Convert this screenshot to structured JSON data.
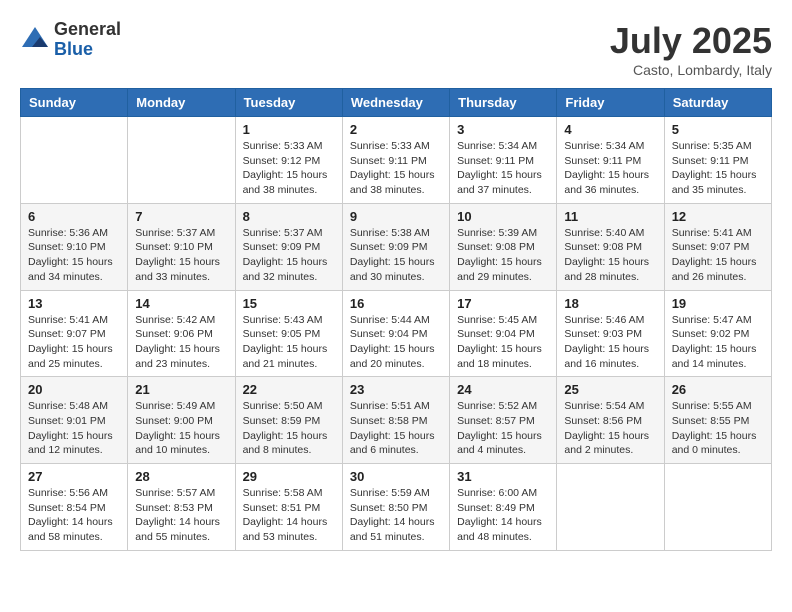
{
  "header": {
    "logo": {
      "general": "General",
      "blue": "Blue"
    },
    "title": "July 2025",
    "location": "Casto, Lombardy, Italy"
  },
  "calendar": {
    "days_of_week": [
      "Sunday",
      "Monday",
      "Tuesday",
      "Wednesday",
      "Thursday",
      "Friday",
      "Saturday"
    ],
    "weeks": [
      [
        {
          "day": "",
          "info": ""
        },
        {
          "day": "",
          "info": ""
        },
        {
          "day": "1",
          "info": "Sunrise: 5:33 AM\nSunset: 9:12 PM\nDaylight: 15 hours and 38 minutes."
        },
        {
          "day": "2",
          "info": "Sunrise: 5:33 AM\nSunset: 9:11 PM\nDaylight: 15 hours and 38 minutes."
        },
        {
          "day": "3",
          "info": "Sunrise: 5:34 AM\nSunset: 9:11 PM\nDaylight: 15 hours and 37 minutes."
        },
        {
          "day": "4",
          "info": "Sunrise: 5:34 AM\nSunset: 9:11 PM\nDaylight: 15 hours and 36 minutes."
        },
        {
          "day": "5",
          "info": "Sunrise: 5:35 AM\nSunset: 9:11 PM\nDaylight: 15 hours and 35 minutes."
        }
      ],
      [
        {
          "day": "6",
          "info": "Sunrise: 5:36 AM\nSunset: 9:10 PM\nDaylight: 15 hours and 34 minutes."
        },
        {
          "day": "7",
          "info": "Sunrise: 5:37 AM\nSunset: 9:10 PM\nDaylight: 15 hours and 33 minutes."
        },
        {
          "day": "8",
          "info": "Sunrise: 5:37 AM\nSunset: 9:09 PM\nDaylight: 15 hours and 32 minutes."
        },
        {
          "day": "9",
          "info": "Sunrise: 5:38 AM\nSunset: 9:09 PM\nDaylight: 15 hours and 30 minutes."
        },
        {
          "day": "10",
          "info": "Sunrise: 5:39 AM\nSunset: 9:08 PM\nDaylight: 15 hours and 29 minutes."
        },
        {
          "day": "11",
          "info": "Sunrise: 5:40 AM\nSunset: 9:08 PM\nDaylight: 15 hours and 28 minutes."
        },
        {
          "day": "12",
          "info": "Sunrise: 5:41 AM\nSunset: 9:07 PM\nDaylight: 15 hours and 26 minutes."
        }
      ],
      [
        {
          "day": "13",
          "info": "Sunrise: 5:41 AM\nSunset: 9:07 PM\nDaylight: 15 hours and 25 minutes."
        },
        {
          "day": "14",
          "info": "Sunrise: 5:42 AM\nSunset: 9:06 PM\nDaylight: 15 hours and 23 minutes."
        },
        {
          "day": "15",
          "info": "Sunrise: 5:43 AM\nSunset: 9:05 PM\nDaylight: 15 hours and 21 minutes."
        },
        {
          "day": "16",
          "info": "Sunrise: 5:44 AM\nSunset: 9:04 PM\nDaylight: 15 hours and 20 minutes."
        },
        {
          "day": "17",
          "info": "Sunrise: 5:45 AM\nSunset: 9:04 PM\nDaylight: 15 hours and 18 minutes."
        },
        {
          "day": "18",
          "info": "Sunrise: 5:46 AM\nSunset: 9:03 PM\nDaylight: 15 hours and 16 minutes."
        },
        {
          "day": "19",
          "info": "Sunrise: 5:47 AM\nSunset: 9:02 PM\nDaylight: 15 hours and 14 minutes."
        }
      ],
      [
        {
          "day": "20",
          "info": "Sunrise: 5:48 AM\nSunset: 9:01 PM\nDaylight: 15 hours and 12 minutes."
        },
        {
          "day": "21",
          "info": "Sunrise: 5:49 AM\nSunset: 9:00 PM\nDaylight: 15 hours and 10 minutes."
        },
        {
          "day": "22",
          "info": "Sunrise: 5:50 AM\nSunset: 8:59 PM\nDaylight: 15 hours and 8 minutes."
        },
        {
          "day": "23",
          "info": "Sunrise: 5:51 AM\nSunset: 8:58 PM\nDaylight: 15 hours and 6 minutes."
        },
        {
          "day": "24",
          "info": "Sunrise: 5:52 AM\nSunset: 8:57 PM\nDaylight: 15 hours and 4 minutes."
        },
        {
          "day": "25",
          "info": "Sunrise: 5:54 AM\nSunset: 8:56 PM\nDaylight: 15 hours and 2 minutes."
        },
        {
          "day": "26",
          "info": "Sunrise: 5:55 AM\nSunset: 8:55 PM\nDaylight: 15 hours and 0 minutes."
        }
      ],
      [
        {
          "day": "27",
          "info": "Sunrise: 5:56 AM\nSunset: 8:54 PM\nDaylight: 14 hours and 58 minutes."
        },
        {
          "day": "28",
          "info": "Sunrise: 5:57 AM\nSunset: 8:53 PM\nDaylight: 14 hours and 55 minutes."
        },
        {
          "day": "29",
          "info": "Sunrise: 5:58 AM\nSunset: 8:51 PM\nDaylight: 14 hours and 53 minutes."
        },
        {
          "day": "30",
          "info": "Sunrise: 5:59 AM\nSunset: 8:50 PM\nDaylight: 14 hours and 51 minutes."
        },
        {
          "day": "31",
          "info": "Sunrise: 6:00 AM\nSunset: 8:49 PM\nDaylight: 14 hours and 48 minutes."
        },
        {
          "day": "",
          "info": ""
        },
        {
          "day": "",
          "info": ""
        }
      ]
    ]
  }
}
